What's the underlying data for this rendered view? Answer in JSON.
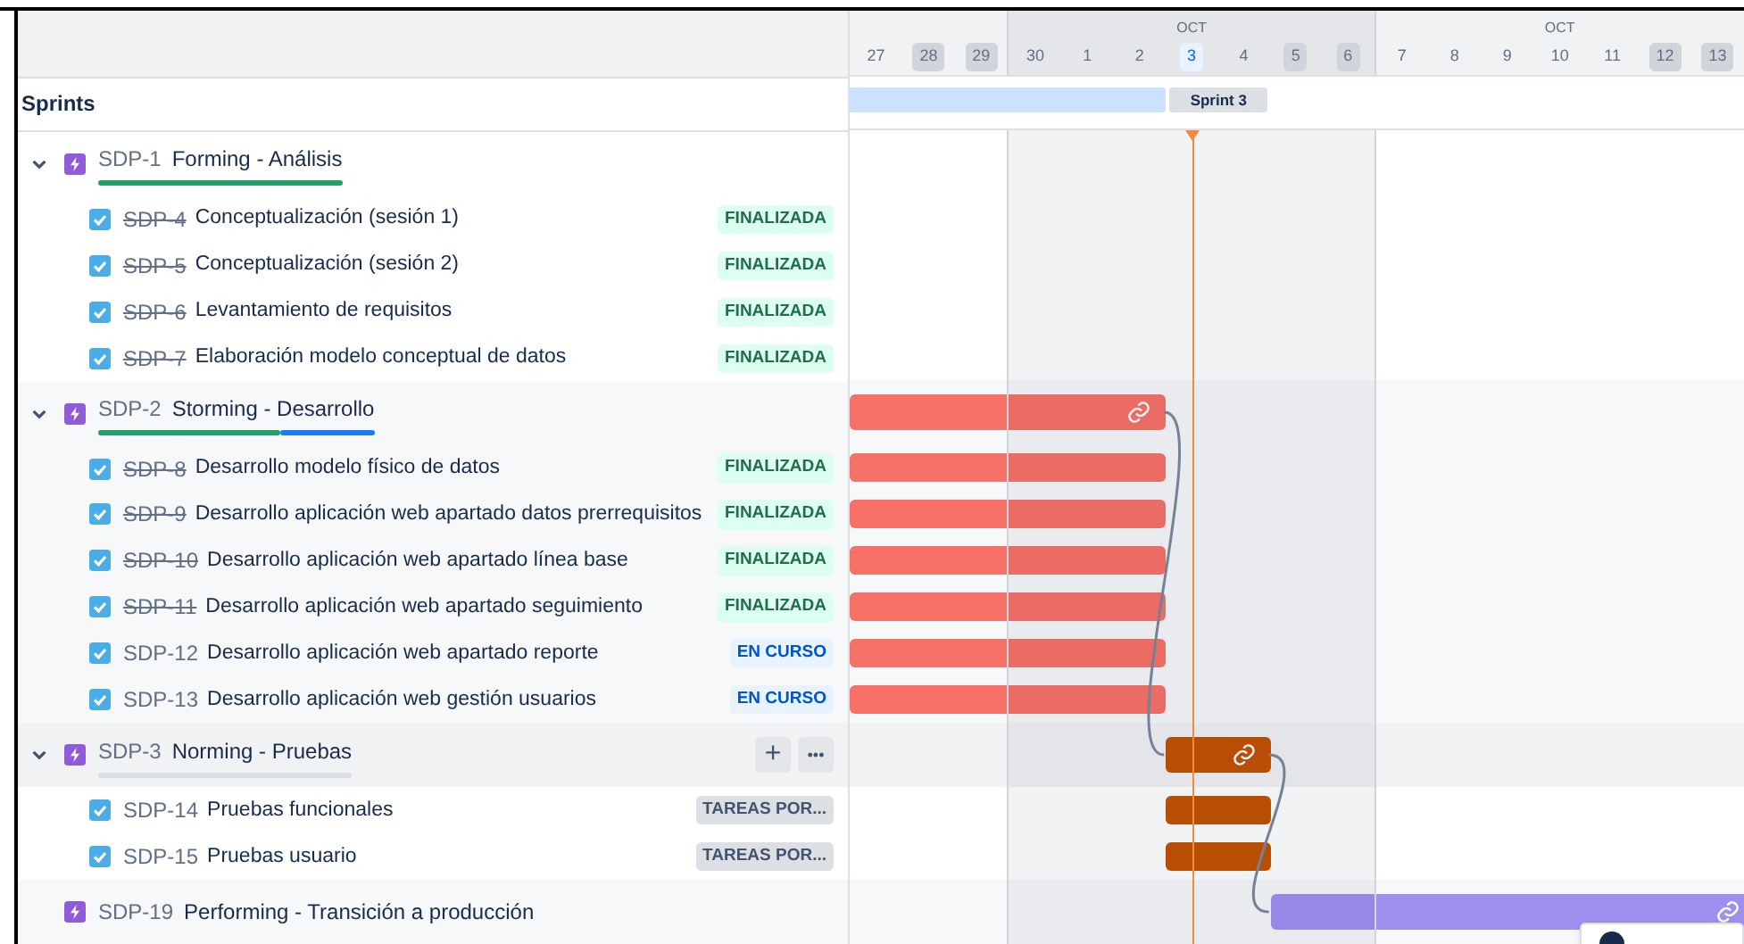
{
  "timeline": {
    "groups": [
      {
        "shaded": false,
        "days": [
          {
            "label": "27",
            "weekend": false,
            "today": false
          },
          {
            "label": "28",
            "weekend": true,
            "today": false
          },
          {
            "label": "29",
            "weekend": true,
            "today": false
          }
        ]
      },
      {
        "month": "OCT",
        "shaded": true,
        "days": [
          {
            "label": "30",
            "weekend": false,
            "today": false
          },
          {
            "label": "1",
            "weekend": false,
            "today": false
          },
          {
            "label": "2",
            "weekend": false,
            "today": false
          },
          {
            "label": "3",
            "weekend": false,
            "today": true
          },
          {
            "label": "4",
            "weekend": false,
            "today": false
          },
          {
            "label": "5",
            "weekend": true,
            "today": false
          },
          {
            "label": "6",
            "weekend": true,
            "today": false
          }
        ]
      },
      {
        "month": "OCT",
        "shaded": false,
        "days": [
          {
            "label": "7",
            "weekend": false,
            "today": false
          },
          {
            "label": "8",
            "weekend": false,
            "today": false
          },
          {
            "label": "9",
            "weekend": false,
            "today": false
          },
          {
            "label": "10",
            "weekend": false,
            "today": false
          },
          {
            "label": "11",
            "weekend": false,
            "today": false
          },
          {
            "label": "12",
            "weekend": true,
            "today": false
          },
          {
            "label": "13",
            "weekend": true,
            "today": false
          }
        ]
      }
    ]
  },
  "sprints": {
    "title": "Sprints",
    "label": "Sprint 3"
  },
  "epics": [
    {
      "key": "SDP-1",
      "title": "Forming - Análisis",
      "expanded": true,
      "hovered": false,
      "progress": [
        {
          "color": "#22a06b",
          "level": 1
        }
      ],
      "children": [
        {
          "key": "SDP-4",
          "title": "Conceptualización (sesión 1)",
          "resolved": true,
          "status": "FINALIZADA",
          "kind": "done"
        },
        {
          "key": "SDP-5",
          "title": "Conceptualización (sesión 2)",
          "resolved": true,
          "status": "FINALIZADA",
          "kind": "done"
        },
        {
          "key": "SDP-6",
          "title": "Levantamiento de requisitos",
          "resolved": true,
          "status": "FINALIZADA",
          "kind": "done"
        },
        {
          "key": "SDP-7",
          "title": "Elaboración modelo conceptual de datos",
          "resolved": true,
          "status": "FINALIZADA",
          "kind": "done"
        }
      ]
    },
    {
      "key": "SDP-2",
      "title": "Storming - Desarrollo",
      "expanded": true,
      "hovered": false,
      "progress": [
        {
          "color": "#22a06b",
          "level": 0.66
        },
        {
          "color": "#1d7afc",
          "level": 0.34
        }
      ],
      "bar": {
        "color": "#f87168",
        "linked": true,
        "open_end": false
      },
      "children": [
        {
          "key": "SDP-8",
          "title": "Desarrollo modelo físico de datos",
          "resolved": true,
          "status": "FINALIZADA",
          "kind": "done",
          "bar": {
            "color": "#f87168"
          }
        },
        {
          "key": "SDP-9",
          "title": "Desarrollo aplicación web apartado datos prerrequisitos",
          "resolved": true,
          "status": "FINALIZADA",
          "kind": "done",
          "bar": {
            "color": "#f87168"
          }
        },
        {
          "key": "SDP-10",
          "title": "Desarrollo aplicación web apartado línea base",
          "resolved": true,
          "status": "FINALIZADA",
          "kind": "done",
          "bar": {
            "color": "#f87168"
          }
        },
        {
          "key": "SDP-11",
          "title": "Desarrollo aplicación web apartado seguimiento",
          "resolved": true,
          "status": "FINALIZADA",
          "kind": "done",
          "bar": {
            "color": "#f87168"
          }
        },
        {
          "key": "SDP-12",
          "title": "Desarrollo aplicación web apartado reporte",
          "resolved": false,
          "status": "EN CURSO",
          "kind": "inprogress",
          "bar": {
            "color": "#f87168"
          }
        },
        {
          "key": "SDP-13",
          "title": "Desarrollo aplicación web gestión usuarios",
          "resolved": false,
          "status": "EN CURSO",
          "kind": "inprogress",
          "bar": {
            "color": "#f87168"
          }
        }
      ]
    },
    {
      "key": "SDP-3",
      "title": "Norming - Pruebas",
      "expanded": true,
      "hovered": true,
      "add_label": "+",
      "more_label": "•••",
      "progress": [
        {
          "color": "#dcdfe4",
          "level": 1
        }
      ],
      "bar": {
        "color": "#c25100",
        "linked": true,
        "open_end": false
      },
      "children": [
        {
          "key": "SDP-14",
          "title": "Pruebas funcionales",
          "resolved": false,
          "status": "TAREAS POR...",
          "kind": "todo",
          "bar": {
            "color": "#c25100"
          }
        },
        {
          "key": "SDP-15",
          "title": "Pruebas usuario",
          "resolved": false,
          "status": "TAREAS POR...",
          "kind": "todo",
          "bar": {
            "color": "#c25100"
          }
        }
      ]
    },
    {
      "key": "SDP-19",
      "title": "Performing - Transición a producción",
      "hovered": false,
      "bar": {
        "color": "#9f8fef",
        "linked": true,
        "open_end": true
      }
    }
  ]
}
